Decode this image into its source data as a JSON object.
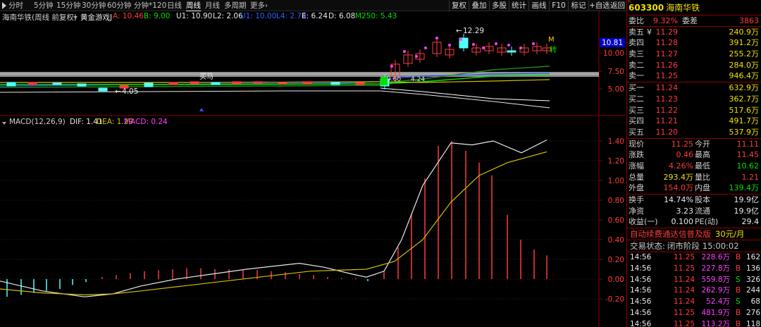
{
  "toolbar": {
    "periods": [
      "分时",
      "5分钟",
      "15分钟",
      "30分钟",
      "60分钟",
      "分钟*120",
      "日线",
      "周线",
      "月线",
      "多周期",
      "更多"
    ],
    "active_period": "周线",
    "more_arrow": "›",
    "buttons": [
      "复权",
      "叠加",
      "多股",
      "统计",
      "画线",
      "F10",
      "标记",
      "+自选",
      "返回"
    ]
  },
  "main_chart": {
    "title": "海南华铁(周线 前复权)",
    "indicator_name": "黄金游戏J",
    "indicators": [
      {
        "text": "A: 10.46",
        "color": "#ff3b3b"
      },
      {
        "text": "B: 9.00",
        "color": "#00e000"
      },
      {
        "text": "U1: 10.90",
        "color": "#e8e8e8"
      },
      {
        "text": "L2: 2.06",
        "color": "#e8e8e8"
      },
      {
        "text": "U1: 10.00",
        "color": "#3060ff"
      },
      {
        "text": "L4: 2.74",
        "color": "#3060ff"
      },
      {
        "text": "E: 6.24",
        "color": "#e8e8e8"
      },
      {
        "text": "D: 6.08",
        "color": "#e8e8e8"
      },
      {
        "text": "M250: 5.43",
        "color": "#00e000"
      }
    ],
    "price_axis": [
      "10.00",
      "7.50",
      "5.00"
    ],
    "price_tag": "10.81",
    "annotations": {
      "high": "12.29",
      "low_left": "4.05",
      "mid": "9.60",
      "mid2": "4.24",
      "buy_label": "买马",
      "zhuan": "转",
      "m_mark": "M"
    }
  },
  "macd": {
    "label": "MACD(12,26,9)",
    "dif": "DIF: 1.41",
    "dea": "DEA: 1.29",
    "macd": "MACD: 0.24",
    "axis": [
      "1.40",
      "1.20",
      "1.00",
      "0.80",
      "0.60",
      "0.40",
      "0.20",
      "0.00",
      "-0.20"
    ]
  },
  "stock": {
    "code": "603300",
    "name": "海南华铁",
    "badge": "R",
    "ratio_label": "委比",
    "ratio_value": "9.32%",
    "diff_label": "委差",
    "diff_value": "3863",
    "asks": [
      {
        "label": "卖五",
        "price": "11.29",
        "vol": "240.9万"
      },
      {
        "label": "卖四",
        "price": "11.28",
        "vol": "391.2万"
      },
      {
        "label": "卖三",
        "price": "11.27",
        "vol": "255.2万"
      },
      {
        "label": "卖二",
        "price": "11.26",
        "vol": "284.0万"
      },
      {
        "label": "卖一",
        "price": "11.25",
        "vol": "946.4万"
      }
    ],
    "ask_mark": "¥",
    "bids": [
      {
        "label": "买一",
        "price": "11.24",
        "vol": "632.9万"
      },
      {
        "label": "买二",
        "price": "11.23",
        "vol": "362.7万"
      },
      {
        "label": "买三",
        "price": "11.22",
        "vol": "517.6万"
      },
      {
        "label": "买四",
        "price": "11.21",
        "vol": "491.7万"
      },
      {
        "label": "买五",
        "price": "11.20",
        "vol": "537.9万"
      }
    ],
    "stats": [
      {
        "l1": "现价",
        "v1": "11.25",
        "c1": "red",
        "l2": "今开",
        "v2": "11.11",
        "c2": "red"
      },
      {
        "l1": "涨跌",
        "v1": "0.46",
        "c1": "red",
        "l2": "最高",
        "v2": "11.45",
        "c2": "red"
      },
      {
        "l1": "涨幅",
        "v1": "4.26%",
        "c1": "red",
        "l2": "最低",
        "v2": "10.62",
        "c2": "green"
      },
      {
        "l1": "总量",
        "v1": "293.4万",
        "c1": "yellow",
        "l2": "量比",
        "v2": "1.21",
        "c2": "red"
      },
      {
        "l1": "外盘",
        "v1": "154.0万",
        "c1": "red",
        "l2": "内盘",
        "v2": "139.4万",
        "c2": "green"
      }
    ],
    "stats2": [
      {
        "l1": "换手",
        "v1": "14.74%",
        "l2": "股本",
        "v2": "19.9亿"
      },
      {
        "l1": "净资",
        "v1": "3.23",
        "l2": "流通",
        "v2": "19.9亿"
      },
      {
        "l1": "收益(一)",
        "v1": "0.100",
        "l2": "PE(动)",
        "v2": "29.4"
      }
    ],
    "ad_text": "自动续费通达信普及版",
    "ad_price": "30元/月",
    "status_label": "交易状态:",
    "status_value": "闭市阶段",
    "status_time": "15:00:02",
    "ticks": [
      {
        "time": "14:56",
        "price": "11.25",
        "pc": "red",
        "vol": "228.6万",
        "side": "B",
        "sc": "red",
        "n": "162"
      },
      {
        "time": "14:56",
        "price": "11.25",
        "pc": "red",
        "vol": "227.8万",
        "side": "B",
        "sc": "red",
        "n": "136"
      },
      {
        "time": "14:56",
        "price": "11.24",
        "pc": "red",
        "vol": "559.8万",
        "side": "S",
        "sc": "green",
        "n": "326"
      },
      {
        "time": "14:56",
        "price": "11.24",
        "pc": "red",
        "vol": "262.9万",
        "side": "B",
        "sc": "red",
        "n": "244"
      },
      {
        "time": "14:56",
        "price": "11.24",
        "pc": "red",
        "vol": "52.4万",
        "side": "S",
        "sc": "green",
        "n": "68"
      },
      {
        "time": "14:56",
        "price": "11.25",
        "pc": "red",
        "vol": "481.9万",
        "side": "B",
        "sc": "red",
        "n": "276"
      },
      {
        "time": "14:56",
        "price": "11.25",
        "pc": "red",
        "vol": "113.2万",
        "side": "B",
        "sc": "red",
        "n": "118"
      },
      {
        "time": "14:56",
        "price": "11.24",
        "pc": "red",
        "vol": "206.0万",
        "side": "S",
        "sc": "green",
        "n": "97"
      }
    ]
  },
  "colors": {
    "up": "#ff3b3b",
    "down": "#54ffff",
    "border": "#8b0000",
    "dif": "#e8e8e8",
    "dea": "#d4c000"
  }
}
